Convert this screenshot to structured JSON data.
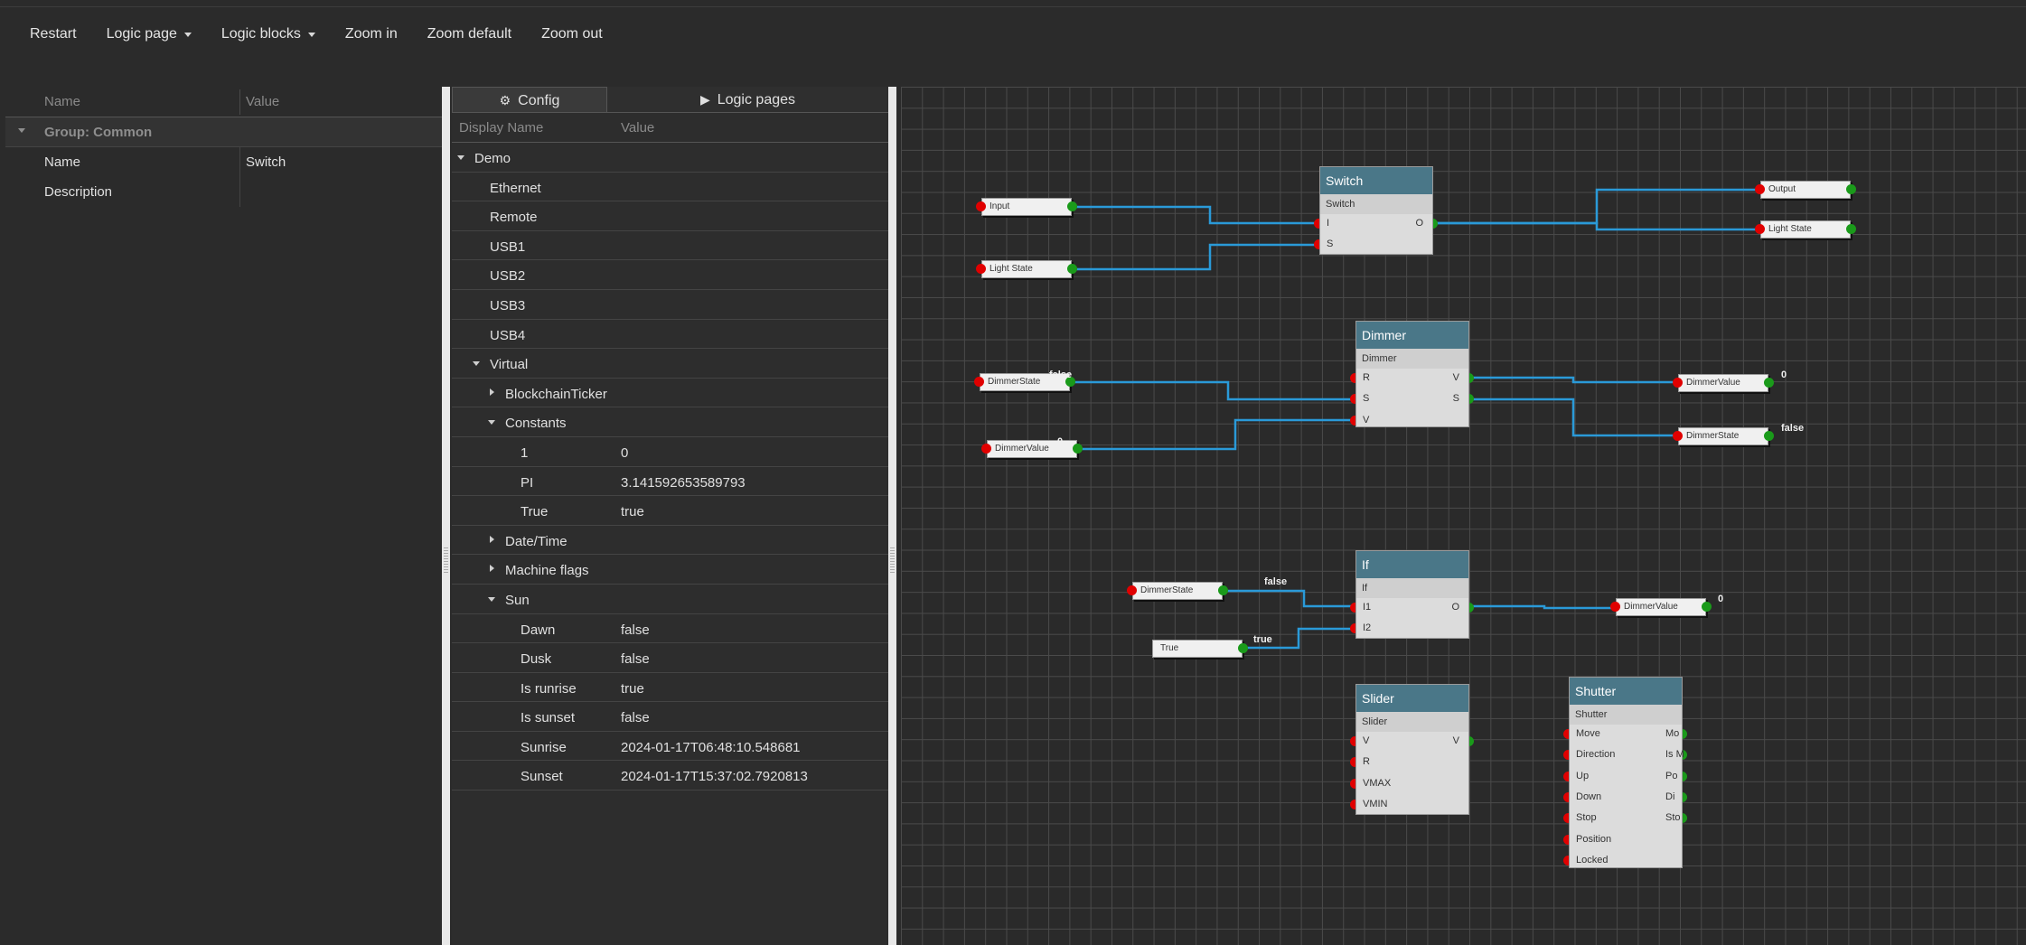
{
  "toolbar": {
    "items": [
      {
        "label": "Restart",
        "dropdown": false
      },
      {
        "label": "Logic page",
        "dropdown": true
      },
      {
        "label": "Logic blocks",
        "dropdown": true
      },
      {
        "label": "Zoom in",
        "dropdown": false
      },
      {
        "label": "Zoom default",
        "dropdown": false
      },
      {
        "label": "Zoom out",
        "dropdown": false
      }
    ]
  },
  "properties": {
    "col_name": "Name",
    "col_value": "Value",
    "group": "Group: Common",
    "rows": [
      {
        "name": "Name",
        "value": "Switch"
      },
      {
        "name": "Description",
        "value": ""
      }
    ]
  },
  "config": {
    "tabs": [
      {
        "label": "Config",
        "icon": "gears-icon",
        "active": true
      },
      {
        "label": "Logic pages",
        "icon": "play-icon",
        "active": false
      }
    ],
    "col_name": "Display Name",
    "col_value": "Value",
    "tree": [
      {
        "label": "Demo",
        "value": "",
        "level": 0,
        "state": "expanded"
      },
      {
        "label": "Ethernet",
        "value": "",
        "level": 1,
        "state": "leaf"
      },
      {
        "label": "Remote",
        "value": "",
        "level": 1,
        "state": "leaf"
      },
      {
        "label": "USB1",
        "value": "",
        "level": 1,
        "state": "leaf"
      },
      {
        "label": "USB2",
        "value": "",
        "level": 1,
        "state": "leaf"
      },
      {
        "label": "USB3",
        "value": "",
        "level": 1,
        "state": "leaf"
      },
      {
        "label": "USB4",
        "value": "",
        "level": 1,
        "state": "leaf"
      },
      {
        "label": "Virtual",
        "value": "",
        "level": 1,
        "state": "expanded"
      },
      {
        "label": "BlockchainTicker",
        "value": "",
        "level": 2,
        "state": "collapsed"
      },
      {
        "label": "Constants",
        "value": "",
        "level": 2,
        "state": "expanded"
      },
      {
        "label": "1",
        "value": "0",
        "level": 3,
        "state": "leaf"
      },
      {
        "label": "PI",
        "value": "3.141592653589793",
        "level": 3,
        "state": "leaf"
      },
      {
        "label": "True",
        "value": "true",
        "level": 3,
        "state": "leaf"
      },
      {
        "label": "Date/Time",
        "value": "",
        "level": 2,
        "state": "collapsed"
      },
      {
        "label": "Machine flags",
        "value": "",
        "level": 2,
        "state": "collapsed"
      },
      {
        "label": "Sun",
        "value": "",
        "level": 2,
        "state": "expanded"
      },
      {
        "label": "Dawn",
        "value": "false",
        "level": 3,
        "state": "leaf"
      },
      {
        "label": "Dusk",
        "value": "false",
        "level": 3,
        "state": "leaf"
      },
      {
        "label": "Is runrise",
        "value": "true",
        "level": 3,
        "state": "leaf"
      },
      {
        "label": "Is sunset",
        "value": "false",
        "level": 3,
        "state": "leaf"
      },
      {
        "label": "Sunrise",
        "value": "2024-01-17T06:48:10.548681",
        "level": 3,
        "state": "leaf"
      },
      {
        "label": "Sunset",
        "value": "2024-01-17T15:37:02.7920813",
        "level": 3,
        "state": "leaf"
      }
    ]
  },
  "canvas": {
    "wire_color": "#2a9ad8",
    "io_nodes": [
      {
        "label": "Input",
        "value": ""
      },
      {
        "label": "Light State",
        "value": ""
      },
      {
        "label": "Output",
        "value": ""
      },
      {
        "label": "Light State",
        "value": ""
      },
      {
        "label": "DimmerState",
        "value": "false"
      },
      {
        "label": "DimmerValue",
        "value": "0"
      },
      {
        "label": "DimmerValue",
        "value": "0"
      },
      {
        "label": "DimmerState",
        "value": "false"
      },
      {
        "label": "DimmerState",
        "value": "false"
      },
      {
        "label": "True",
        "value": "true"
      },
      {
        "label": "DimmerValue",
        "value": "0"
      }
    ],
    "blocks": [
      {
        "title": "Switch",
        "subtitle": "Switch",
        "inputs": [
          "I",
          "S"
        ],
        "outputs": [
          "O"
        ]
      },
      {
        "title": "Dimmer",
        "subtitle": "Dimmer",
        "inputs": [
          "R",
          "S",
          "V"
        ],
        "outputs": [
          "V",
          "S"
        ]
      },
      {
        "title": "If",
        "subtitle": "If",
        "inputs": [
          "I1",
          "I2"
        ],
        "outputs": [
          "O"
        ]
      },
      {
        "title": "Slider",
        "subtitle": "Slider",
        "inputs": [
          "V",
          "R",
          "VMAX",
          "VMIN"
        ],
        "outputs": [
          "V"
        ]
      },
      {
        "title": "Shutter",
        "subtitle": "Shutter",
        "inputs": [
          "Move",
          "Direction",
          "Up",
          "Down",
          "Stop",
          "Position",
          "Locked"
        ],
        "outputs": [
          "Mo",
          "Is M",
          "Po",
          "Di",
          "Sto"
        ]
      }
    ]
  }
}
